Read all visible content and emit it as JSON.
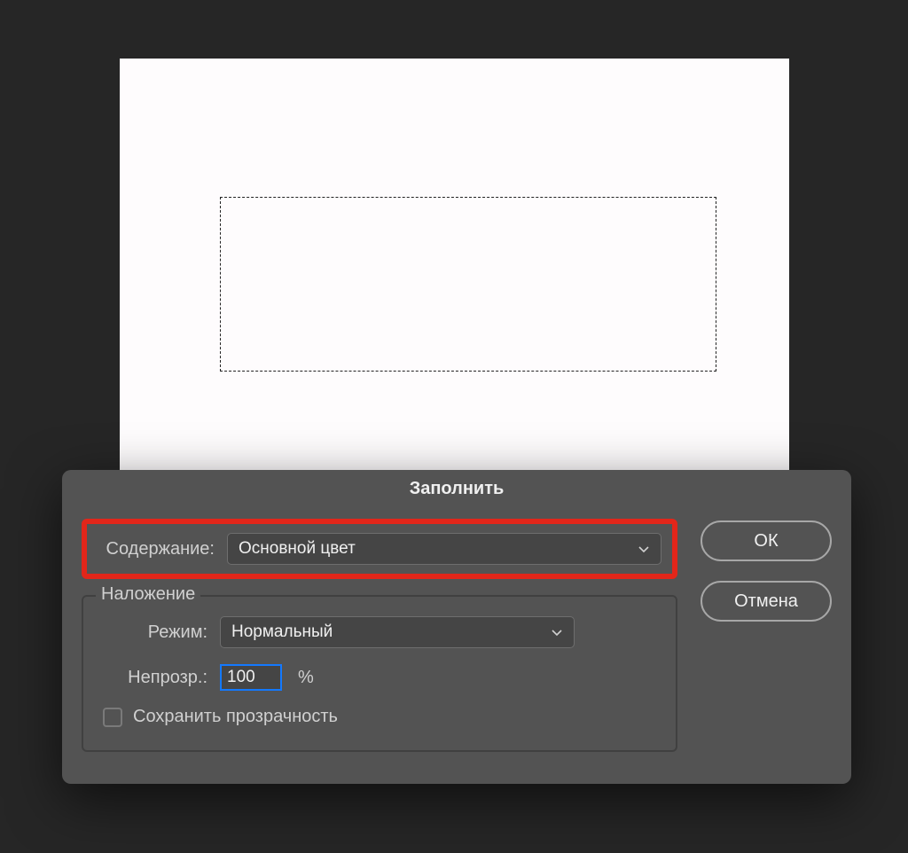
{
  "dialog": {
    "title": "Заполнить",
    "content": {
      "label": "Содержание:",
      "value": "Основной цвет"
    },
    "blending": {
      "legend": "Наложение",
      "mode_label": "Режим:",
      "mode_value": "Нормальный",
      "opacity_label": "Непрозр.:",
      "opacity_value": "100",
      "opacity_unit": "%",
      "preserve_label": "Сохранить прозрачность",
      "preserve_checked": false
    },
    "buttons": {
      "ok": "ОК",
      "cancel": "Отмена"
    }
  }
}
